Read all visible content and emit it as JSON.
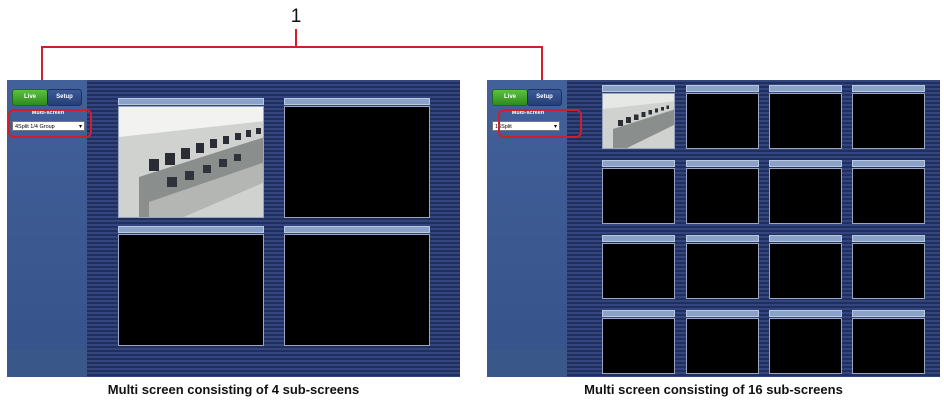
{
  "callout": {
    "number": "1"
  },
  "panels": [
    {
      "live_label": "Live",
      "setup_label": "Setup",
      "multiscreen_label": "Multi-screen",
      "select_value": "4Split 1/4 Group",
      "caption": "Multi screen consisting of 4 sub-screens"
    },
    {
      "live_label": "Live",
      "setup_label": "Setup",
      "multiscreen_label": "Multi-screen",
      "select_value": "16Split",
      "caption": "Multi screen consisting of 16 sub-screens"
    }
  ],
  "colors": {
    "callout_line": "#d21e2a",
    "live_button": "#3ea82a",
    "setup_button": "#2f4c88",
    "background": "#22336a"
  }
}
